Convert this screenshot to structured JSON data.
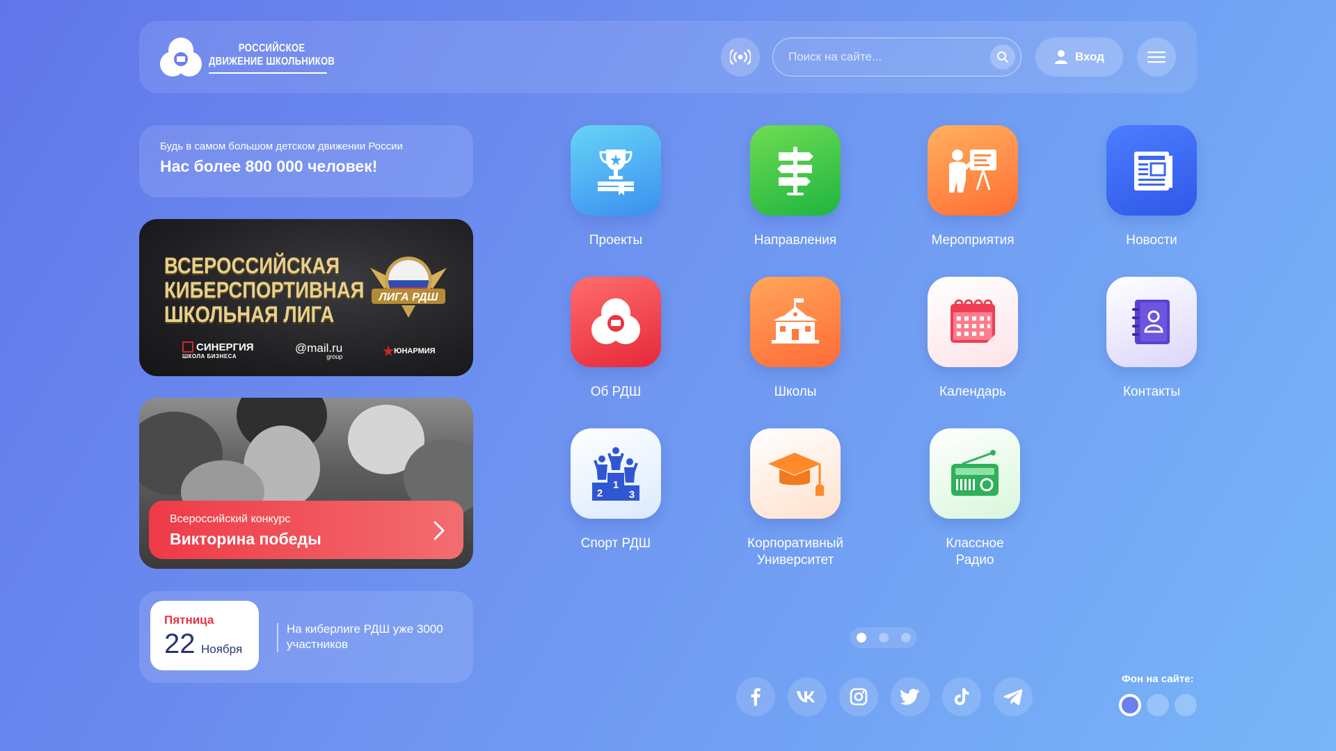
{
  "header": {
    "logo_line1": "РОССИЙСКОЕ",
    "logo_line2": "ДВИЖЕНИЕ ШКОЛЬНИКОВ",
    "search_placeholder": "Поиск на сайте...",
    "login_label": "Вход",
    "icons": {
      "radio": "radio-broadcast-icon",
      "search": "search-icon",
      "user": "user-icon",
      "menu": "hamburger-menu-icon"
    }
  },
  "intro": {
    "subtitle": "Будь в самом большом детском движении России",
    "headline": "Нас более 800 000 человек!"
  },
  "esports_banner": {
    "title_line1": "ВСЕРОССИЙСКАЯ",
    "title_line2": "КИБЕРСПОРТИВНАЯ",
    "title_line3": "ШКОЛЬНАЯ ЛИГА",
    "badge_text": "ЛИГА РДШ",
    "sponsor1": "СИНЕРГИЯ",
    "sponsor1_sub": "ШКОЛА БИЗНЕСА",
    "sponsor2": "@mail.ru",
    "sponsor2_sub": "group",
    "sponsor3": "ЮНАРМИЯ"
  },
  "victory_card": {
    "subtitle": "Всероссийский конкурс",
    "title": "Викторина победы"
  },
  "date_card": {
    "weekday": "Пятница",
    "day": "22",
    "month": "Ноября",
    "news": "На киберлиге РДШ уже 3000 участников"
  },
  "tiles": [
    {
      "label": "Проекты",
      "icon": "trophy-book-icon"
    },
    {
      "label": "Направления",
      "icon": "signpost-icon"
    },
    {
      "label": "Мероприятия",
      "icon": "presentation-icon"
    },
    {
      "label": "Новости",
      "icon": "newspaper-icon"
    },
    {
      "label": "Об РДШ",
      "icon": "rdsh-logo-icon"
    },
    {
      "label": "Школы",
      "icon": "school-building-icon"
    },
    {
      "label": "Календарь",
      "icon": "calendar-icon"
    },
    {
      "label": "Контакты",
      "icon": "contacts-book-icon"
    },
    {
      "label": "Спорт РДШ",
      "icon": "podium-icon"
    },
    {
      "label_line1": "Корпоративный",
      "label_line2": "Университет",
      "icon": "graduation-cap-icon"
    },
    {
      "label_line1": "Классное",
      "label_line2": "Радио",
      "icon": "radio-icon"
    }
  ],
  "pagination": {
    "pages": 3,
    "active": 1
  },
  "social": [
    "facebook-icon",
    "vk-icon",
    "instagram-icon",
    "twitter-icon",
    "tiktok-icon",
    "telegram-icon"
  ],
  "background_chooser": {
    "label": "Фон на сайте:",
    "options": 3,
    "active": 1
  },
  "colors": {
    "accent_red": "#e5333f",
    "navy": "#263472",
    "bg_start": "#6176ea",
    "bg_end": "#78b6f8"
  }
}
